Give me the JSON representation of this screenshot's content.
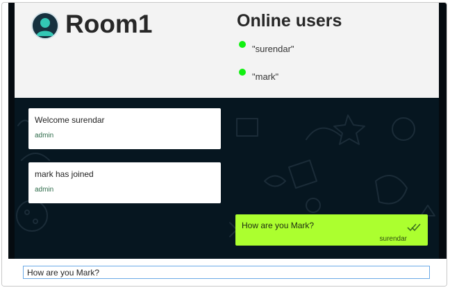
{
  "room": {
    "title": "Room1",
    "avatar_icon": "user-avatar-icon"
  },
  "online": {
    "title": "Online users",
    "status_color": "#11f011",
    "users": [
      {
        "name": "\"surendar\""
      },
      {
        "name": "\"mark\""
      }
    ]
  },
  "messages": [
    {
      "text": "Welcome surendar",
      "author": "admin"
    },
    {
      "text": "mark has joined",
      "author": "admin"
    }
  ],
  "own_message": {
    "text": "How are you Mark?",
    "author": "surendar",
    "status_icon": "double-check-icon",
    "bubble_color": "#acff2f"
  },
  "composer": {
    "value": "How are you Mark?"
  },
  "colors": {
    "chat_background": "#061620",
    "header_background": "#f3f3f3"
  }
}
